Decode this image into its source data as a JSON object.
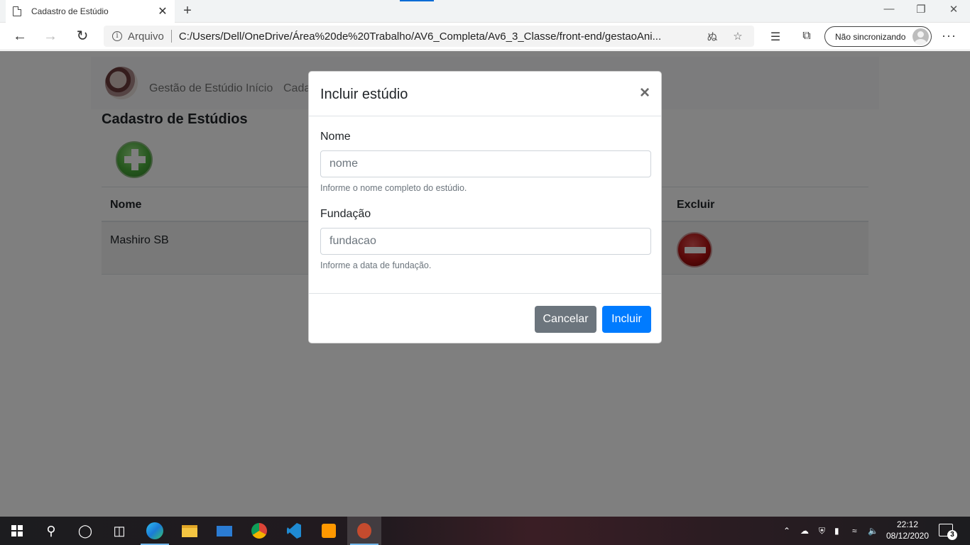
{
  "browser": {
    "tab_title": "Cadastro de Estúdio",
    "tab_close": "✕",
    "new_tab": "+",
    "scheme_label": "Arquivo",
    "url": "C:/Users/Dell/OneDrive/Área%20de%20Trabalho/AV6_Completa/Av6_3_Classe/front-end/gestaoAni...",
    "sync_label": "Não sincronizando",
    "icons": [
      "back-icon",
      "forward-icon",
      "refresh-icon",
      "info-icon",
      "read-aloud-icon",
      "favorite-star-icon",
      "favorites-icon",
      "collections-icon",
      "more-icon"
    ]
  },
  "navbar": {
    "brand": "Gestão de Estúdio",
    "links": [
      "Início",
      "Cada"
    ]
  },
  "page": {
    "heading": "Cadastro de Estúdios",
    "table": {
      "columns": [
        "Nome",
        "Excluir"
      ],
      "rows": [
        {
          "nome": "Mashiro SB"
        }
      ]
    }
  },
  "modal": {
    "title": "Incluir estúdio",
    "close": "×",
    "fields": [
      {
        "label": "Nome",
        "placeholder": "nome",
        "help": "Informe o nome completo do estúdio."
      },
      {
        "label": "Fundação",
        "placeholder": "fundacao",
        "help": "Informe a data de fundação."
      }
    ],
    "cancel_label": "Cancelar",
    "submit_label": "Incluir",
    "colors": {
      "primary": "#007bff",
      "secondary": "#6c757d"
    }
  },
  "taskbar": {
    "time": "22:12",
    "date": "08/12/2020",
    "notifications": "3",
    "apps": [
      "start",
      "search",
      "cortana",
      "task-view",
      "edge",
      "file-explorer",
      "mail",
      "chrome",
      "vscode",
      "sublime",
      "app-active"
    ]
  }
}
